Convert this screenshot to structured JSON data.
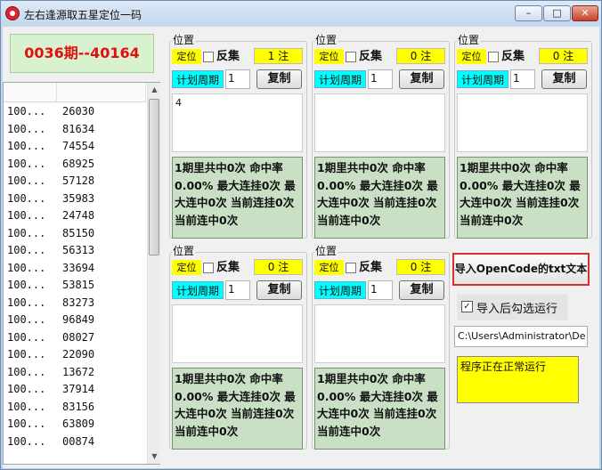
{
  "window": {
    "title": "左右逢源取五星定位一码",
    "controls": {
      "minimize": "–",
      "maximize": "□",
      "close": "✕"
    }
  },
  "issue_label": "0036期--40164",
  "list": {
    "rows": [
      [
        "100...",
        "26030"
      ],
      [
        "100...",
        "81634"
      ],
      [
        "100...",
        "74554"
      ],
      [
        "100...",
        "68925"
      ],
      [
        "100...",
        "57128"
      ],
      [
        "100...",
        "35983"
      ],
      [
        "100...",
        "24748"
      ],
      [
        "100...",
        "85150"
      ],
      [
        "100...",
        "56313"
      ],
      [
        "100...",
        "33694"
      ],
      [
        "100...",
        "53815"
      ],
      [
        "100...",
        "83273"
      ],
      [
        "100...",
        "96849"
      ],
      [
        "100...",
        "08027"
      ],
      [
        "100...",
        "22090"
      ],
      [
        "100...",
        "13672"
      ],
      [
        "100...",
        "37914"
      ],
      [
        "100...",
        "83156"
      ],
      [
        "100...",
        "63809"
      ],
      [
        "100...",
        "00874"
      ]
    ]
  },
  "panels": [
    {
      "label": "位置",
      "dingwei": "定位",
      "fanji": "反集",
      "zhu": "1 注",
      "jihua": "计划周期",
      "period": "1",
      "copy": "复制",
      "text": "4",
      "result": "1期里共中0次 命中率0.00% 最大连挂0次 最大连中0次 当前连挂0次 当前连中0次"
    },
    {
      "label": "位置",
      "dingwei": "定位",
      "fanji": "反集",
      "zhu": "0 注",
      "jihua": "计划周期",
      "period": "1",
      "copy": "复制",
      "text": "",
      "result": "1期里共中0次 命中率0.00% 最大连挂0次 最大连中0次 当前连挂0次 当前连中0次"
    },
    {
      "label": "位置",
      "dingwei": "定位",
      "fanji": "反集",
      "zhu": "0 注",
      "jihua": "计划周期",
      "period": "1",
      "copy": "复制",
      "text": "",
      "result": "1期里共中0次 命中率0.00% 最大连挂0次 最大连中0次 当前连挂0次 当前连中0次"
    },
    {
      "label": "位置",
      "dingwei": "定位",
      "fanji": "反集",
      "zhu": "0 注",
      "jihua": "计划周期",
      "period": "1",
      "copy": "复制",
      "text": "",
      "result": "1期里共中0次 命中率0.00% 最大连挂0次 最大连中0次 当前连挂0次 当前连中0次"
    },
    {
      "label": "位置",
      "dingwei": "定位",
      "fanji": "反集",
      "zhu": "0 注",
      "jihua": "计划周期",
      "period": "1",
      "copy": "复制",
      "text": "",
      "result": "1期里共中0次 命中率0.00% 最大连挂0次 最大连中0次 当前连挂0次 当前连中0次"
    }
  ],
  "import_button": "导入OpenCode的txt文本",
  "auto_run": {
    "label": "导入后勾选运行",
    "checked": true
  },
  "path": "C:\\Users\\Administrator\\De",
  "status": "程序正在正常运行"
}
